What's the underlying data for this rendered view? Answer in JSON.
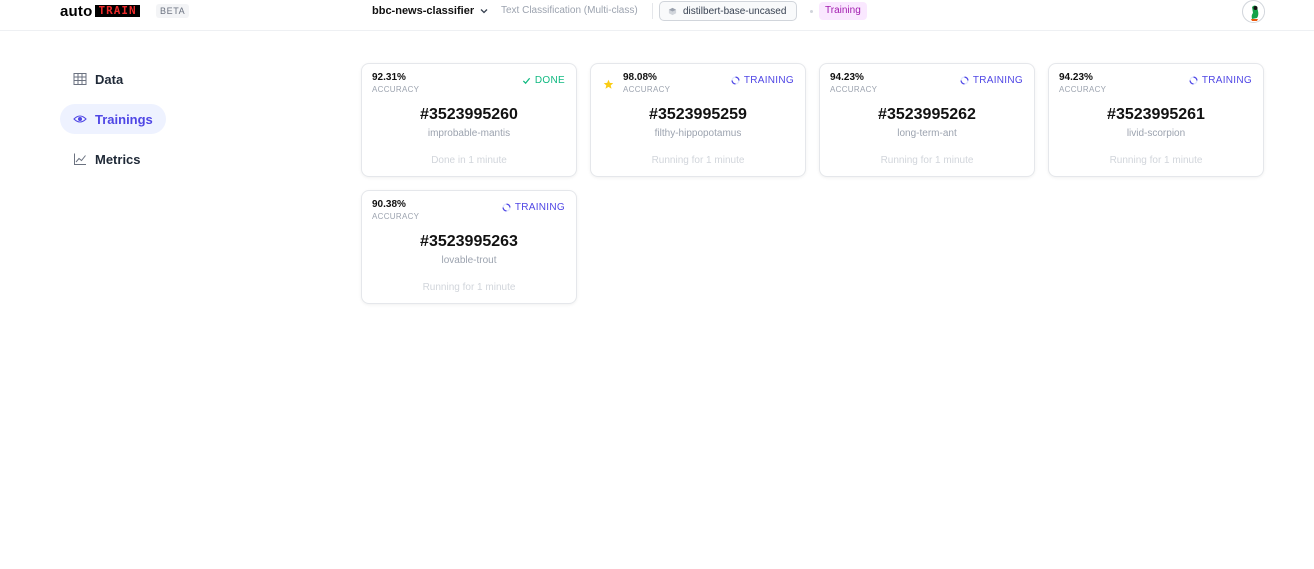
{
  "header": {
    "logo_auto": "auto",
    "logo_train": "TRAIN",
    "beta": "BETA",
    "project": "bbc-news-classifier",
    "task": "Text Classification (Multi-class)",
    "model": "distilbert-base-uncased",
    "status": "Training"
  },
  "sidebar": {
    "items": [
      {
        "label": "Data",
        "icon": "table-icon"
      },
      {
        "label": "Trainings",
        "icon": "eye-icon",
        "active": true
      },
      {
        "label": "Metrics",
        "icon": "chart-line-icon"
      }
    ]
  },
  "colors": {
    "accent": "#4f46e5",
    "done": "#10b981",
    "training": "#4f46e5",
    "star": "#facc15",
    "status_pill_bg": "#fae8ff",
    "status_pill_text": "#a21caf"
  },
  "cards": [
    {
      "accuracy": "92.31%",
      "accuracy_label": "ACCURACY",
      "state": "DONE",
      "id": "#3523995260",
      "name": "improbable-mantis",
      "time": "Done in 1 minute",
      "best": false
    },
    {
      "accuracy": "98.08%",
      "accuracy_label": "ACCURACY",
      "state": "TRAINING",
      "id": "#3523995259",
      "name": "filthy-hippopotamus",
      "time": "Running for 1 minute",
      "best": true
    },
    {
      "accuracy": "94.23%",
      "accuracy_label": "ACCURACY",
      "state": "TRAINING",
      "id": "#3523995262",
      "name": "long-term-ant",
      "time": "Running for 1 minute",
      "best": false
    },
    {
      "accuracy": "94.23%",
      "accuracy_label": "ACCURACY",
      "state": "TRAINING",
      "id": "#3523995261",
      "name": "livid-scorpion",
      "time": "Running for 1 minute",
      "best": false
    },
    {
      "accuracy": "90.38%",
      "accuracy_label": "ACCURACY",
      "state": "TRAINING",
      "id": "#3523995263",
      "name": "lovable-trout",
      "time": "Running for 1 minute",
      "best": false
    }
  ]
}
